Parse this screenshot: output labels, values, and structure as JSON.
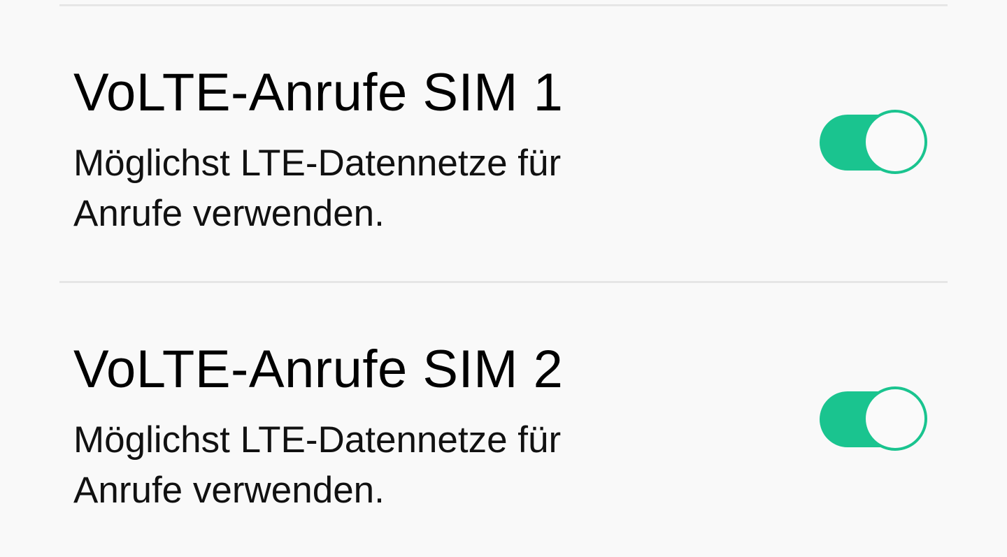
{
  "settings": [
    {
      "title": "VoLTE-Anrufe SIM 1",
      "description": "Möglichst LTE-Datennetze für Anrufe verwenden.",
      "enabled": true
    },
    {
      "title": "VoLTE-Anrufe SIM 2",
      "description": "Möglichst LTE-Datennetze für Anrufe verwenden.",
      "enabled": true
    }
  ],
  "colors": {
    "background": "#f9f9f9",
    "divider": "#e6e6e6",
    "switch_on": "#1ac48f",
    "knob": "#fafafa"
  }
}
